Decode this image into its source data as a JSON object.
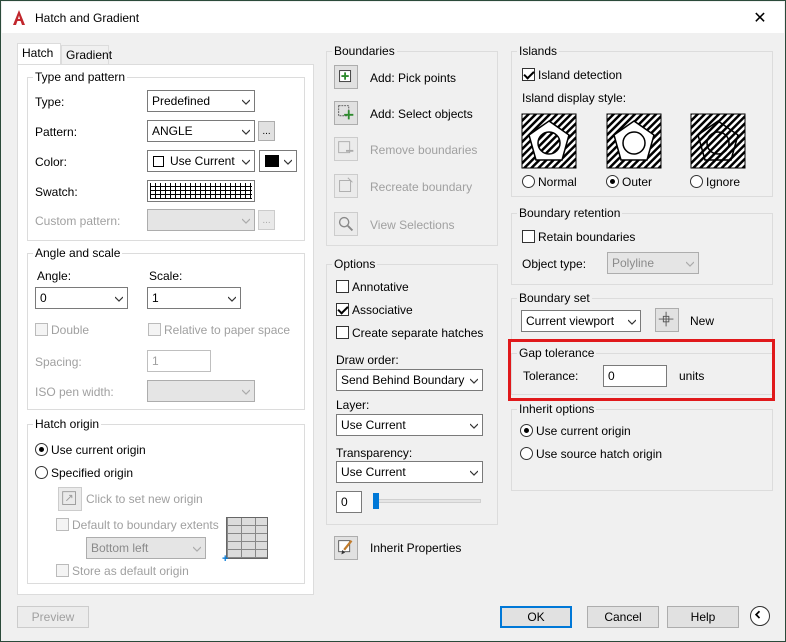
{
  "window": {
    "title": "Hatch and Gradient",
    "close_glyph": "✕"
  },
  "tabs": [
    {
      "label": "Hatch",
      "active": true
    },
    {
      "label": "Gradient",
      "active": false
    }
  ],
  "type_pattern": {
    "group_label": "Type and pattern",
    "type_label": "Type:",
    "type_value": "Predefined",
    "pattern_label": "Pattern:",
    "pattern_value": "ANGLE",
    "color_label": "Color:",
    "color_value": "Use Current",
    "swatch_label": "Swatch:",
    "custom_pattern_label": "Custom pattern:",
    "browse_glyph": "..."
  },
  "angle_scale": {
    "group_label": "Angle and scale",
    "angle_label": "Angle:",
    "angle_value": "0",
    "scale_label": "Scale:",
    "scale_value": "1",
    "double_label": "Double",
    "relative_label": "Relative to paper space",
    "spacing_label": "Spacing:",
    "spacing_value": "1",
    "iso_label": "ISO pen width:"
  },
  "hatch_origin": {
    "group_label": "Hatch origin",
    "use_current_label": "Use current origin",
    "specified_label": "Specified origin",
    "click_set_label": "Click to set new origin",
    "default_extents_label": "Default to boundary extents",
    "extent_position": "Bottom left",
    "store_default_label": "Store as default origin"
  },
  "boundaries": {
    "group_label": "Boundaries",
    "pick_points": "Add: Pick points",
    "select_objects": "Add: Select objects",
    "remove": "Remove boundaries",
    "recreate": "Recreate boundary",
    "view": "View Selections"
  },
  "options": {
    "group_label": "Options",
    "annotative": "Annotative",
    "associative": "Associative",
    "separate": "Create separate hatches",
    "draw_order_label": "Draw order:",
    "draw_order_value": "Send Behind Boundary",
    "layer_label": "Layer:",
    "layer_value": "Use Current",
    "transparency_label": "Transparency:",
    "transparency_value": "Use Current",
    "transparency_amount": "0",
    "transparency_level": 0
  },
  "inherit_properties": "Inherit Properties",
  "islands": {
    "group_label": "Islands",
    "detection_label": "Island detection",
    "display_style_label": "Island display style:",
    "normal": "Normal",
    "outer": "Outer",
    "ignore": "Ignore"
  },
  "boundary_retention": {
    "group_label": "Boundary retention",
    "retain_label": "Retain boundaries",
    "object_type_label": "Object type:",
    "object_type_value": "Polyline"
  },
  "boundary_set": {
    "group_label": "Boundary set",
    "value": "Current viewport",
    "new_label": "New"
  },
  "gap_tolerance": {
    "group_label": "Gap tolerance",
    "tolerance_label": "Tolerance:",
    "tolerance_value": "0",
    "units_label": "units",
    "highlight_color": "#e0191b"
  },
  "inherit_options": {
    "group_label": "Inherit options",
    "use_current": "Use current origin",
    "use_source": "Use source hatch origin"
  },
  "footer": {
    "preview": "Preview",
    "ok": "OK",
    "cancel": "Cancel",
    "help": "Help"
  },
  "colors": {
    "accent": "#0078d7",
    "app_icon": "#c1272d"
  }
}
